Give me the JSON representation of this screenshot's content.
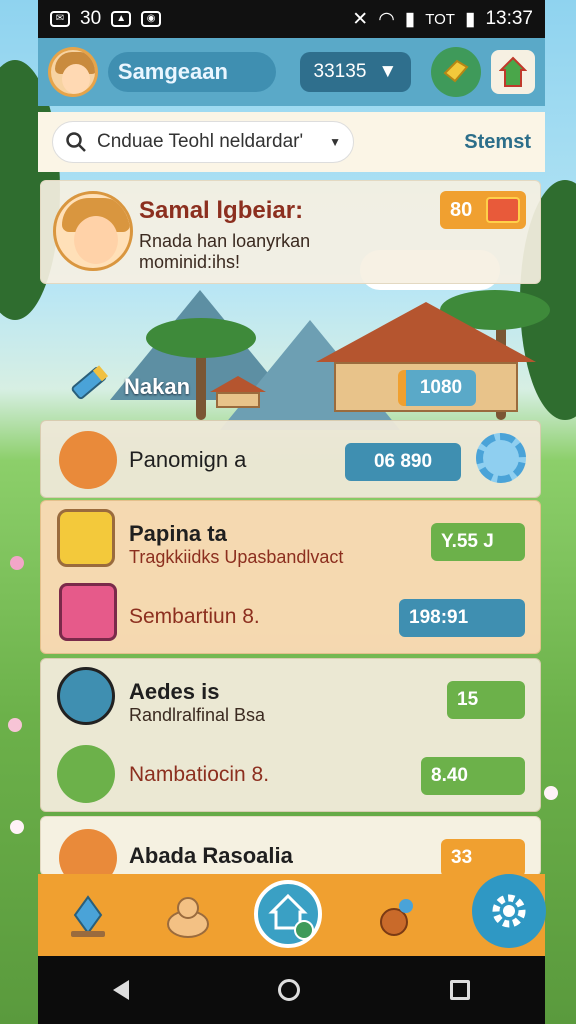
{
  "status_bar": {
    "left_number": "30",
    "time": "13:37",
    "carrier": "TOT"
  },
  "header": {
    "player_name": "Samgeaan",
    "coins": "33135"
  },
  "search": {
    "placeholder": "Cnduae Teohl neldardar'",
    "status_label": "Stemst"
  },
  "profile": {
    "title": "Samal lgbeiar:",
    "description": "Rnada han loanyrkan mominid:ihs!",
    "badge_value": "80"
  },
  "scene": {
    "label": "Nakan",
    "badge_value": "1080"
  },
  "list": [
    {
      "title": "Panomign a",
      "pill": "06 890",
      "icon": "fox-icon"
    },
    {
      "title": "Papina ta",
      "subtitle": "Tragkkiidks Upasbandlvact",
      "pill": "Y.55 J",
      "icon": "calculator-icon"
    },
    {
      "title": "Sembartiun 8.",
      "pill": "198:91",
      "icon": "phone-icon"
    },
    {
      "title": "Aedes is",
      "subtitle": "Randlralfinal Bsa",
      "pill": "15",
      "icon": "farmer-icon"
    },
    {
      "title": "Nambatiocin 8.",
      "pill": "8.40",
      "icon": "pencil-icon"
    },
    {
      "title": "Abada Rasoalia",
      "pill": "33",
      "icon": "fox-icon"
    }
  ],
  "colors": {
    "accent_blue": "#5aa9c8",
    "accent_orange": "#f0a030",
    "accent_green": "#6cb14a",
    "title_red": "#8c2f1f"
  }
}
